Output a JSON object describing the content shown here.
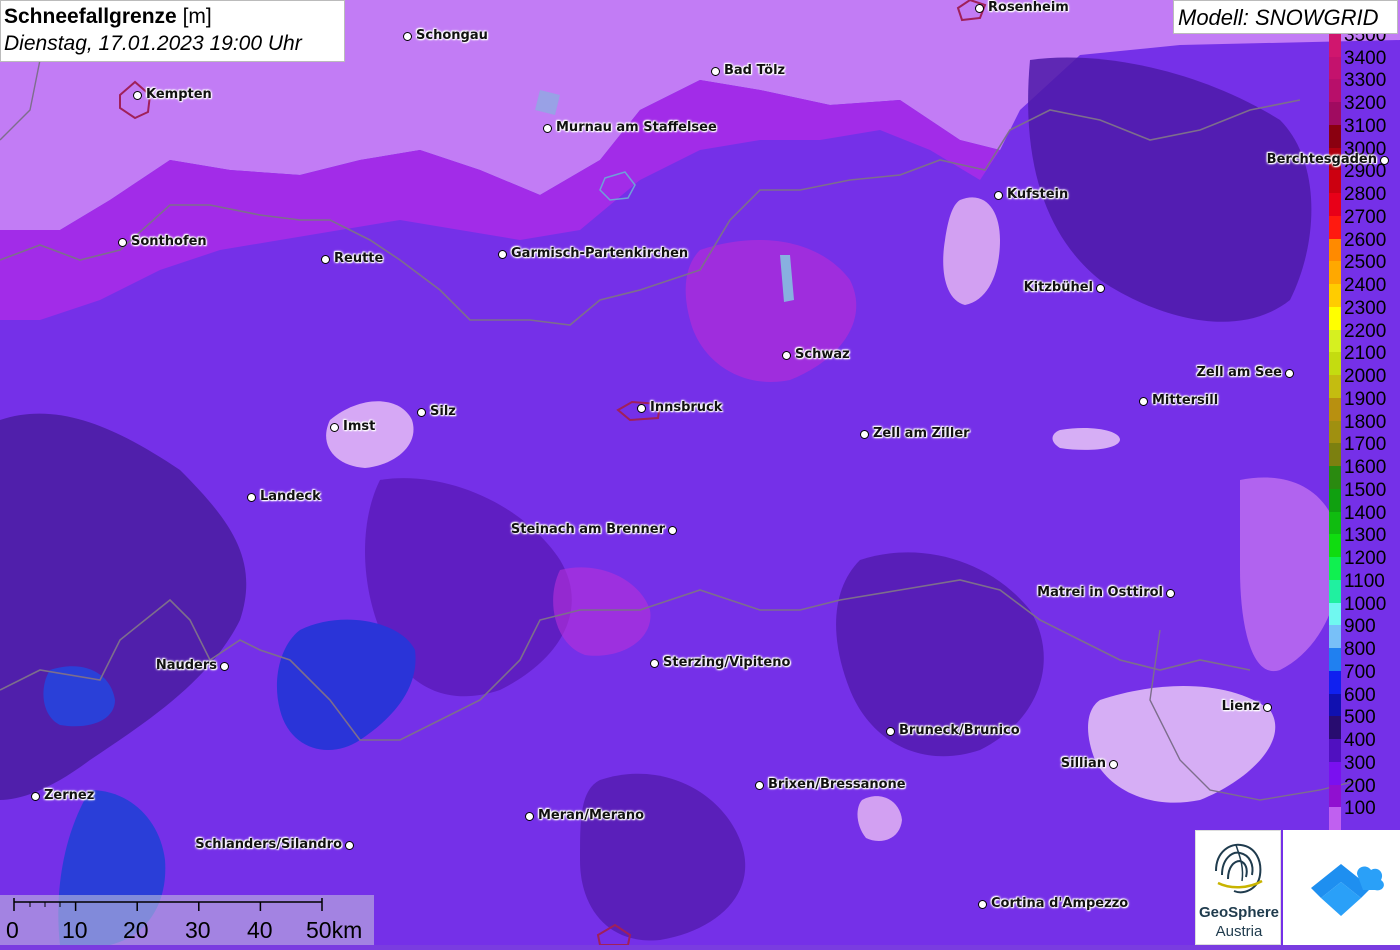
{
  "title": {
    "main": "Schneefallgrenze",
    "unit": "[m]",
    "datetime": "Dienstag, 17.01.2023 19:00 Uhr"
  },
  "model": "Modell: SNOWGRID",
  "legend": [
    {
      "label": "3500",
      "color": "#d0166e"
    },
    {
      "label": "3400",
      "color": "#c4126d"
    },
    {
      "label": "3300",
      "color": "#b80f6a"
    },
    {
      "label": "3200",
      "color": "#a00b60"
    },
    {
      "label": "3100",
      "color": "#8a0010"
    },
    {
      "label": "3000",
      "color": "#b00010"
    },
    {
      "label": "2900",
      "color": "#cc0010"
    },
    {
      "label": "2800",
      "color": "#e80018"
    },
    {
      "label": "2700",
      "color": "#ff1a10"
    },
    {
      "label": "2600",
      "color": "#ff8a00"
    },
    {
      "label": "2500",
      "color": "#ffa800"
    },
    {
      "label": "2400",
      "color": "#ffcc00"
    },
    {
      "label": "2300",
      "color": "#ffff00"
    },
    {
      "label": "2200",
      "color": "#d6f020"
    },
    {
      "label": "2100",
      "color": "#c4dc10"
    },
    {
      "label": "2000",
      "color": "#c4bc10"
    },
    {
      "label": "1900",
      "color": "#b89010"
    },
    {
      "label": "1800",
      "color": "#a09010"
    },
    {
      "label": "1700",
      "color": "#7c8010"
    },
    {
      "label": "1600",
      "color": "#2a8a10"
    },
    {
      "label": "1500",
      "color": "#10a010"
    },
    {
      "label": "1400",
      "color": "#10bc10"
    },
    {
      "label": "1300",
      "color": "#10dc10"
    },
    {
      "label": "1200",
      "color": "#10f050"
    },
    {
      "label": "1100",
      "color": "#20f0a0"
    },
    {
      "label": "1000",
      "color": "#70f8f0"
    },
    {
      "label": "900",
      "color": "#78c0f8"
    },
    {
      "label": "800",
      "color": "#2080f0"
    },
    {
      "label": "700",
      "color": "#1020f0"
    },
    {
      "label": "600",
      "color": "#1010b0"
    },
    {
      "label": "500",
      "color": "#280c70"
    },
    {
      "label": "400",
      "color": "#5010c0"
    },
    {
      "label": "300",
      "color": "#7a10f0"
    },
    {
      "label": "200",
      "color": "#9010d0"
    },
    {
      "label": "100",
      "color": "#c060f0"
    }
  ],
  "cities": [
    {
      "name": "Rosenheim"
    },
    {
      "name": "Schongau"
    },
    {
      "name": "Kempten"
    },
    {
      "name": "Bad Tölz"
    },
    {
      "name": "Murnau am Staffelsee"
    },
    {
      "name": "Berchtesgaden"
    },
    {
      "name": "Kufstein"
    },
    {
      "name": "Sonthofen"
    },
    {
      "name": "Reutte"
    },
    {
      "name": "Garmisch-Partenkirchen"
    },
    {
      "name": "Kitzbühel"
    },
    {
      "name": "Schwaz"
    },
    {
      "name": "Zell am See"
    },
    {
      "name": "Mittersill"
    },
    {
      "name": "Imst"
    },
    {
      "name": "Silz"
    },
    {
      "name": "Innsbruck"
    },
    {
      "name": "Zell am Ziller"
    },
    {
      "name": "Landeck"
    },
    {
      "name": "Steinach am Brenner"
    },
    {
      "name": "Matrei in Osttirol"
    },
    {
      "name": "Nauders"
    },
    {
      "name": "Sterzing/Vipiteno"
    },
    {
      "name": "Lienz"
    },
    {
      "name": "Bruneck/Brunico"
    },
    {
      "name": "Sillian"
    },
    {
      "name": "Brixen/Bressanone"
    },
    {
      "name": "Zernez"
    },
    {
      "name": "Meran/Merano"
    },
    {
      "name": "Schlanders/Silandro"
    },
    {
      "name": "Cortina d'Ampezzo"
    }
  ],
  "scale": [
    "0",
    "10",
    "20",
    "30",
    "40",
    "50km"
  ],
  "logos": {
    "geosphere_line1": "GeoSphere",
    "geosphere_line2": "Austria"
  }
}
